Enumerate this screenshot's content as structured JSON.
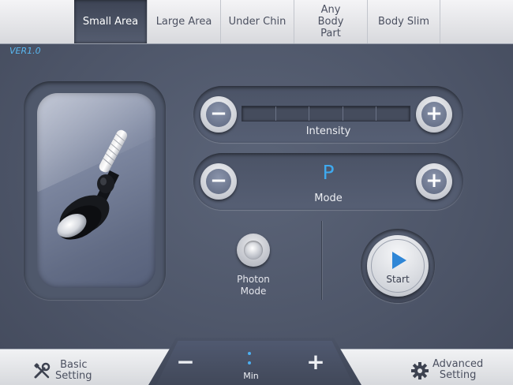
{
  "tabs": [
    {
      "label": "Small Area",
      "active": true
    },
    {
      "label": "Large Area",
      "active": false
    },
    {
      "label": "Under Chin",
      "active": false
    },
    {
      "label": "Any Body Part",
      "active": false
    },
    {
      "label": "Body Slim",
      "active": false
    }
  ],
  "version": "VER1.0",
  "intensity": {
    "label": "Intensity",
    "segments": 5,
    "level": 0,
    "minus_icon": "minus-icon",
    "plus_icon": "plus-icon"
  },
  "mode": {
    "label": "Mode",
    "value": "P"
  },
  "photon": {
    "label_line1": "Photon",
    "label_line2": "Mode"
  },
  "start": {
    "label": "Start",
    "icon": "play-icon"
  },
  "timer": {
    "unit": "Min"
  },
  "bottom": {
    "basic": {
      "line1": "Basic",
      "line2": "Setting",
      "icon": "wrench-screwdriver-icon"
    },
    "advanced": {
      "line1": "Advanced",
      "line2": "Setting",
      "icon": "gear-icon"
    }
  },
  "colors": {
    "accent": "#3fa9ee",
    "panel": "#4d5568",
    "bar": "#e4e5e8"
  }
}
